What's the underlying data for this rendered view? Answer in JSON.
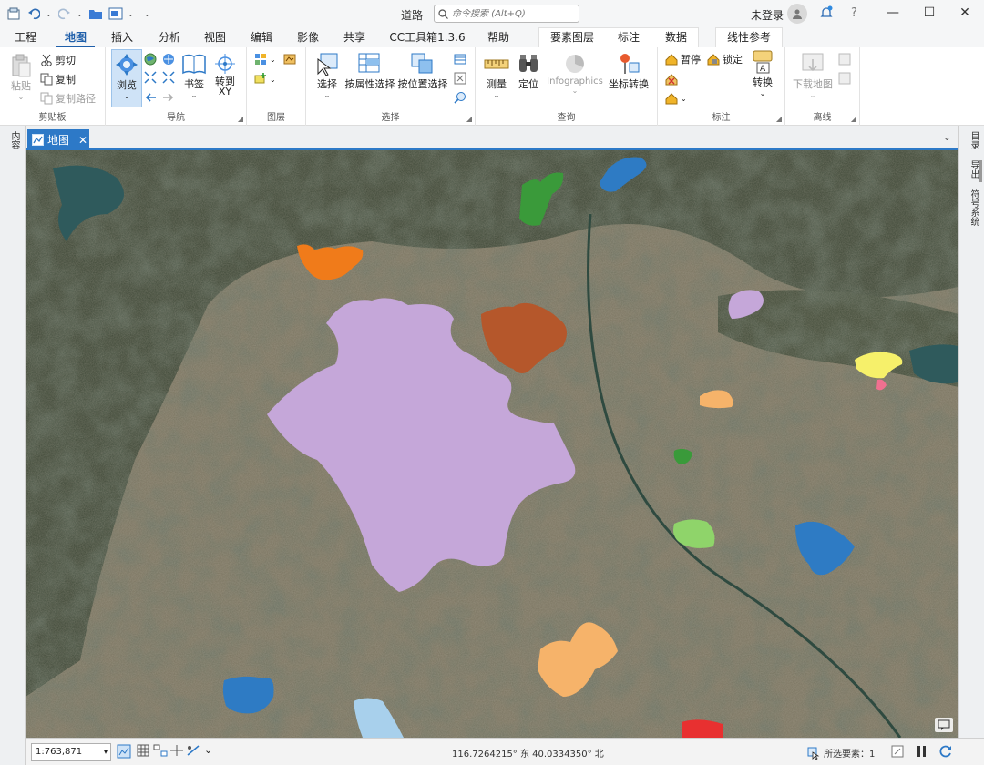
{
  "title": "道路",
  "search": {
    "placeholder": "命令搜索 (Alt+Q)"
  },
  "account": {
    "login_label": "未登录"
  },
  "tabs": [
    "工程",
    "地图",
    "插入",
    "分析",
    "视图",
    "编辑",
    "影像",
    "共享",
    "CC工具箱1.3.6",
    "帮助",
    "要素图层",
    "标注",
    "数据",
    "线性参考"
  ],
  "active_tab": "地图",
  "ribbon": {
    "clipboard": {
      "label": "剪贴板",
      "paste": "粘贴",
      "cut": "剪切",
      "copy": "复制",
      "copy_path": "复制路径"
    },
    "navigate": {
      "label": "导航",
      "explore": "浏览",
      "bookmarks": "书签",
      "goto_xy": "转到\nXY"
    },
    "layer": {
      "label": "图层"
    },
    "selection": {
      "label": "选择",
      "select": "选择",
      "by_attr": "按属性选择",
      "by_loc": "按位置选择"
    },
    "inquiry": {
      "label": "查询",
      "measure": "测量",
      "locate": "定位",
      "infographics": "Infographics",
      "convert_coords": "坐标转换"
    },
    "labeling": {
      "label": "标注",
      "pause": "暂停",
      "lock": "锁定",
      "convert": "转换"
    },
    "offline": {
      "label": "离线",
      "download_map": "下载地图"
    }
  },
  "left_pane_label": "内容",
  "view_tab": {
    "label": "地图"
  },
  "right_pane": [
    "目录",
    "导出",
    "符号系统"
  ],
  "status": {
    "scale": "1:763,871",
    "coords": "116.7264215° 东  40.0334350° 北",
    "selected_label": "所选要素：1"
  },
  "colors": {
    "accent": "#2d79c7",
    "ribbon_active": "#1f5faa"
  }
}
